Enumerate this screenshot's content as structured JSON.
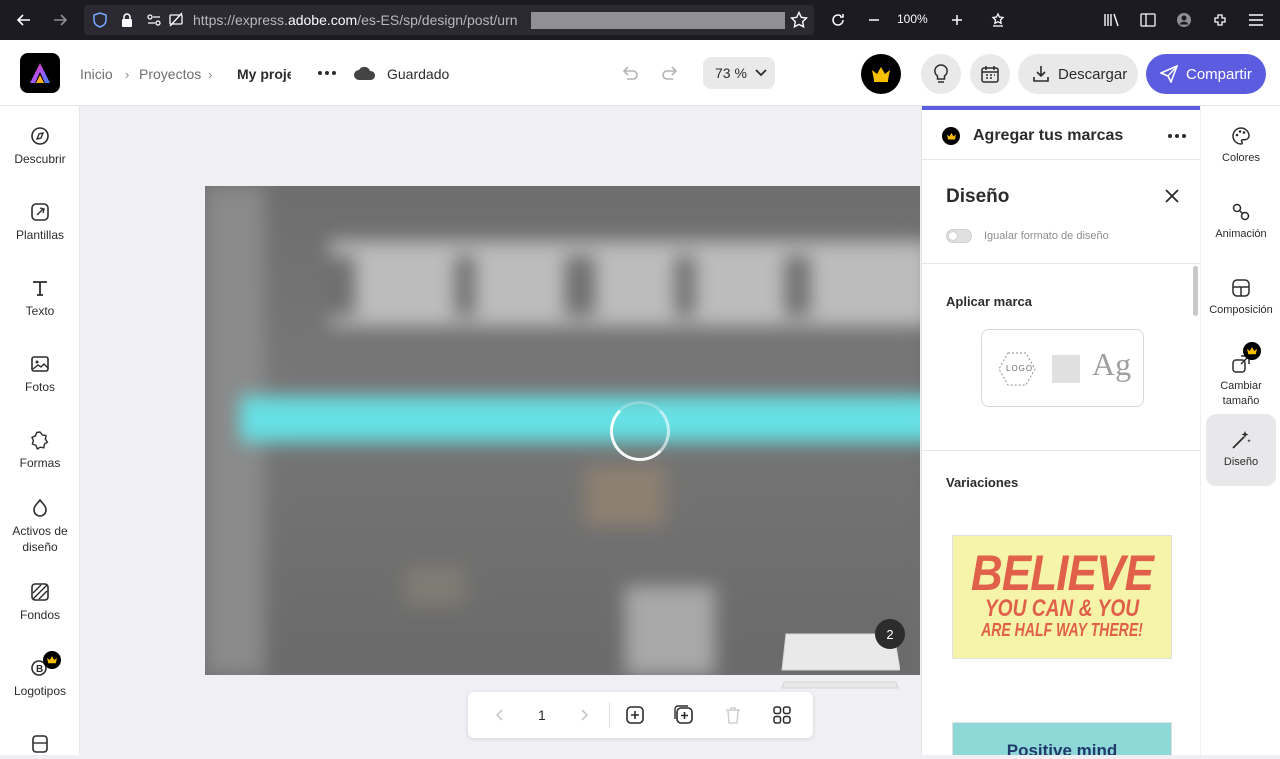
{
  "browser": {
    "url_prefix": "https://express.",
    "url_domain": "adobe.com",
    "url_path": "/es-ES/sp/design/post/urn",
    "zoom": "100%"
  },
  "header": {
    "breadcrumb": [
      "Inicio",
      "Proyectos",
      "My proje"
    ],
    "status": "Guardado",
    "zoom": "73 %",
    "download_label": "Descargar",
    "share_label": "Compartir"
  },
  "left_rail": {
    "items": [
      "Descubrir",
      "Plantillas",
      "Texto",
      "Fotos",
      "Formas",
      "Activos de diseño",
      "Fondos",
      "Logotipos"
    ]
  },
  "canvas": {
    "page_number": "1",
    "page_count": "2"
  },
  "panel": {
    "title": "Agregar tus marcas",
    "section_title": "Diseño",
    "toggle_label": "Igualar formato de diseño",
    "apply_brand_label": "Aplicar marca",
    "logo_text": "LOGO",
    "font_sample": "Ag",
    "variations_label": "Variaciones",
    "variation1": {
      "line1": "BELIEVE",
      "line2": "YOU CAN & YOU",
      "line3": "ARE HALF WAY THERE!"
    },
    "variation2": {
      "line1": "Positive mind"
    }
  },
  "right_rail": {
    "items": [
      "Colores",
      "Animación",
      "Composición",
      "Cambiar tamaño",
      "Diseño"
    ]
  },
  "colors": {
    "accent": "#5c5ce0",
    "variation1_bg": "#f5f4a8",
    "variation1_text": "#e0604a",
    "variation2_bg": "#8fd8d8"
  }
}
